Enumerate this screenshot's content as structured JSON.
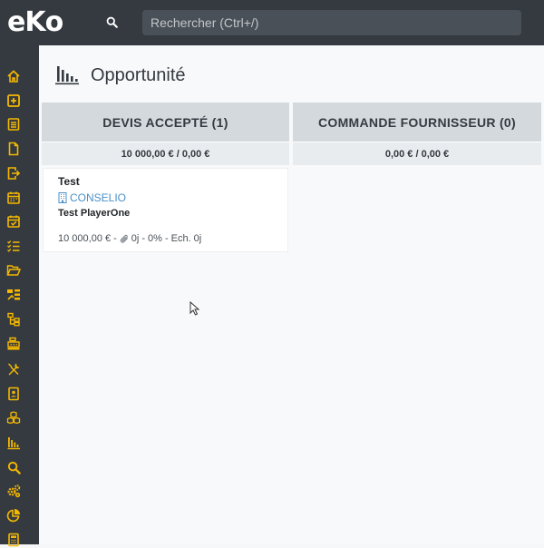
{
  "app": {
    "logo_text": "eKo",
    "logo_prefix": "e",
    "logo_k": "K",
    "logo_suffix": "o"
  },
  "search": {
    "placeholder": "Rechercher (Ctrl+/)"
  },
  "sidebar": {
    "items": [
      {
        "icon": "home-icon"
      },
      {
        "icon": "plus-square-icon"
      },
      {
        "icon": "list-alt-icon"
      },
      {
        "icon": "file-icon"
      },
      {
        "icon": "file-export-icon"
      },
      {
        "icon": "calendar-icon"
      },
      {
        "icon": "calendar-check-icon"
      },
      {
        "icon": "tasks-icon"
      },
      {
        "icon": "folder-open-icon"
      },
      {
        "icon": "project-diagram-icon"
      },
      {
        "icon": "sitemap-icon"
      },
      {
        "icon": "cash-register-icon"
      },
      {
        "icon": "tools-icon"
      },
      {
        "icon": "id-card-icon"
      },
      {
        "icon": "cubes-icon"
      },
      {
        "icon": "chart-bars-icon"
      },
      {
        "icon": "search-icon"
      },
      {
        "icon": "cogs-icon"
      },
      {
        "icon": "chart-pie-icon"
      },
      {
        "icon": "calculator-icon"
      }
    ]
  },
  "page": {
    "title": "Opportunité",
    "title_icon": "chart-bars-icon"
  },
  "columns": [
    {
      "title": "DEVIS ACCEPTÉ (1)",
      "total": "10 000,00 € / 0,00 €"
    },
    {
      "title": "COMMANDE FOURNISSEUR (0)",
      "total": "0,00 € / 0,00 €"
    }
  ],
  "card": {
    "title": "Test",
    "company": "CONSELIO",
    "contact": "Test PlayerOne",
    "amount": "10 000,00 €",
    "sep1": "-",
    "days": "0j",
    "sep2": "-",
    "percent": "0%",
    "sep3": "-",
    "due": "Ech. 0j"
  },
  "colors": {
    "topbar": "#343a40",
    "sidebar_icon": "#f5b800",
    "column_header": "#d4d9de",
    "link": "#4a90c8"
  }
}
